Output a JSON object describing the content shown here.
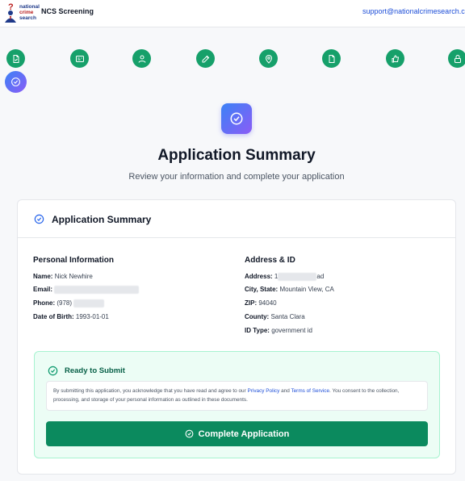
{
  "header": {
    "logo_text": [
      "national",
      "crime",
      "search"
    ],
    "app_name": "NCS Screening",
    "support_email": "support@nationalcrimesearch.com"
  },
  "steps": [
    {
      "icon": "document-icon",
      "status": "complete"
    },
    {
      "icon": "id-card-icon",
      "status": "complete"
    },
    {
      "icon": "user-icon",
      "status": "complete"
    },
    {
      "icon": "pencil-icon",
      "status": "complete"
    },
    {
      "icon": "location-pin-icon",
      "status": "complete"
    },
    {
      "icon": "document-icon",
      "status": "complete"
    },
    {
      "icon": "thumbs-up-icon",
      "status": "complete"
    },
    {
      "icon": "lock-icon",
      "status": "complete"
    },
    {
      "icon": "check-circle-icon",
      "status": "current"
    }
  ],
  "page": {
    "title": "Application Summary",
    "subtitle": "Review your information and complete your application"
  },
  "card": {
    "title": "Application Summary",
    "personal": {
      "title": "Personal Information",
      "name_label": "Name:",
      "name_value": "Nick Newhire",
      "email_label": "Email:",
      "phone_label": "Phone:",
      "phone_value": "(978)",
      "dob_label": "Date of Birth:",
      "dob_value": "1993-01-01"
    },
    "address": {
      "title": "Address & ID",
      "address_label": "Address:",
      "address_prefix": "1",
      "address_suffix": "ad",
      "city_label": "City, State:",
      "city_value": "Mountain View, CA",
      "zip_label": "ZIP:",
      "zip_value": "94040",
      "county_label": "County:",
      "county_value": "Santa Clara",
      "idtype_label": "ID Type:",
      "idtype_value": "government id"
    },
    "submit": {
      "ready_title": "Ready to Submit",
      "consent_text_1": "By submitting this application, you acknowledge that you have read and agree to our",
      "privacy_link": "Privacy Policy",
      "and_text": "and",
      "terms_link": "Terms of Service",
      "consent_text_2": ". You consent to the collection, processing, and storage of your personal information as outlined in these documents.",
      "button_label": "Complete Application"
    }
  },
  "colors": {
    "step_green": "#16a06a",
    "accent_gradient_start": "#3b82f6",
    "accent_gradient_end": "#8b5cf6",
    "submit_button": "#0b8a5e",
    "link": "#1d4ed8"
  }
}
